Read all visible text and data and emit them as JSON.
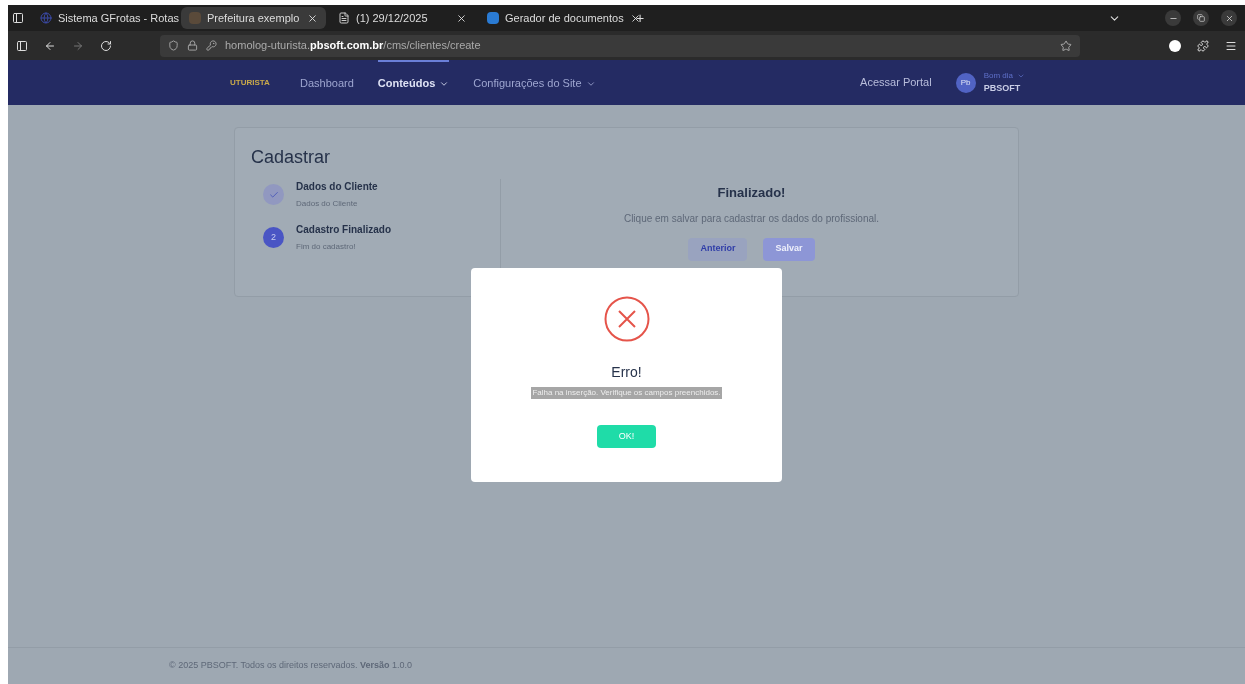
{
  "browser": {
    "tabs": [
      {
        "title": "Sistema GFrotas - Rotas",
        "selected": false,
        "kind": "globe"
      },
      {
        "title": "Prefeitura exemplo",
        "selected": true,
        "kind": "site"
      },
      {
        "title": "(1) 29/12/2025",
        "selected": false,
        "kind": "doc"
      },
      {
        "title": "Gerador de documentos",
        "selected": false,
        "kind": "app"
      }
    ],
    "new_tab": "+",
    "url": "homolog-uturista.**pbsoft.com.br**/cms/clientes/create"
  },
  "navbar": {
    "logo": "UTURISTA",
    "items": [
      {
        "label": "Dashboard",
        "selected": false,
        "dropdown": false
      },
      {
        "label": "Conteúdos",
        "selected": true,
        "dropdown": true
      },
      {
        "label": "Configurações do Site",
        "selected": false,
        "dropdown": true
      }
    ],
    "portal_link": "Acessar Portal",
    "avatar": "Pb",
    "greeting": "Bom dia",
    "user": "PBSOFT"
  },
  "card": {
    "title": "Cadastrar",
    "steps": [
      {
        "title": "Dados do Cliente",
        "subtitle": "Dados do Cliente",
        "done": true
      },
      {
        "title": "Cadastro Finalizado",
        "subtitle": "Fim do cadastro!",
        "done": false,
        "number": "2"
      }
    ],
    "panel_title": "Finalizado!",
    "panel_text": "Clique em salvar para cadastrar os dados do profissional.",
    "buttons": [
      {
        "label": "Anterior",
        "kind": "secondary"
      },
      {
        "label": "Salvar",
        "kind": "primary"
      }
    ]
  },
  "dialog": {
    "title": "Erro!",
    "message": "Falha na inserção. Verifique os campos preenchidos.",
    "button": "OK!"
  },
  "footer": "© 2025 PBSOFT. Todos os direitos reservados. **Versão** 1.0.0"
}
